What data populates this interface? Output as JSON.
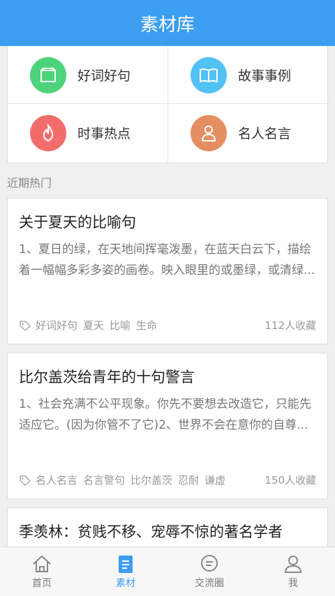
{
  "header": {
    "title": "素材库"
  },
  "categories": [
    {
      "label": "好词好句",
      "icon": "bookmark-box-icon",
      "color": "#4cd37c"
    },
    {
      "label": "故事事例",
      "icon": "open-book-icon",
      "color": "#52c1f4"
    },
    {
      "label": "时事热点",
      "icon": "flame-icon",
      "color": "#f36c6c"
    },
    {
      "label": "名人名言",
      "icon": "person-icon",
      "color": "#e58e63"
    }
  ],
  "section_title": "近期热门",
  "articles": [
    {
      "title": "关于夏天的比喻句",
      "excerpt": "1、夏日的绿，在天地间挥毫泼墨，在蓝天白云下，描绘着一幅幅多彩多姿的画卷。映入眼里的或墨绿，或清绿...",
      "tags": [
        "好词好句",
        "夏天",
        "比喻",
        "生命"
      ],
      "favorites": "112人收藏"
    },
    {
      "title": "比尔盖茨给青年的十句警言",
      "excerpt": "1、社会充满不公平现象。你先不要想去改造它，只能先适应它。(因为你管不了它)2、世界不会在意你的自尊...",
      "tags": [
        "名人名言",
        "名言警句",
        "比尔盖茨",
        "忍耐",
        "谦虚"
      ],
      "favorites": "150人收藏"
    },
    {
      "title": "季羡林：贫贱不移、宠辱不惊的著名学者"
    }
  ],
  "tabs": [
    {
      "label": "首页",
      "icon": "home-icon"
    },
    {
      "label": "素材",
      "icon": "document-icon",
      "active": true
    },
    {
      "label": "交流圈",
      "icon": "chat-icon"
    },
    {
      "label": "我",
      "icon": "user-icon"
    }
  ],
  "colors": {
    "accent": "#3c9ef0"
  }
}
